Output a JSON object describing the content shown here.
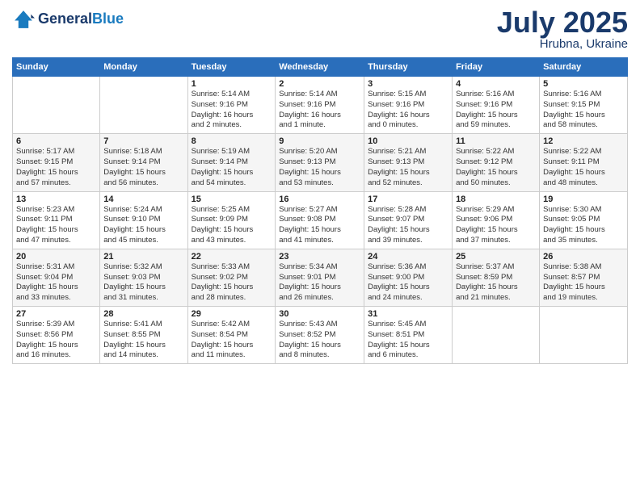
{
  "header": {
    "logo_general": "General",
    "logo_blue": "Blue",
    "month": "July 2025",
    "location": "Hrubna, Ukraine"
  },
  "days_of_week": [
    "Sunday",
    "Monday",
    "Tuesday",
    "Wednesday",
    "Thursday",
    "Friday",
    "Saturday"
  ],
  "weeks": [
    [
      {
        "day": "",
        "detail": ""
      },
      {
        "day": "",
        "detail": ""
      },
      {
        "day": "1",
        "detail": "Sunrise: 5:14 AM\nSunset: 9:16 PM\nDaylight: 16 hours\nand 2 minutes."
      },
      {
        "day": "2",
        "detail": "Sunrise: 5:14 AM\nSunset: 9:16 PM\nDaylight: 16 hours\nand 1 minute."
      },
      {
        "day": "3",
        "detail": "Sunrise: 5:15 AM\nSunset: 9:16 PM\nDaylight: 16 hours\nand 0 minutes."
      },
      {
        "day": "4",
        "detail": "Sunrise: 5:16 AM\nSunset: 9:16 PM\nDaylight: 15 hours\nand 59 minutes."
      },
      {
        "day": "5",
        "detail": "Sunrise: 5:16 AM\nSunset: 9:15 PM\nDaylight: 15 hours\nand 58 minutes."
      }
    ],
    [
      {
        "day": "6",
        "detail": "Sunrise: 5:17 AM\nSunset: 9:15 PM\nDaylight: 15 hours\nand 57 minutes."
      },
      {
        "day": "7",
        "detail": "Sunrise: 5:18 AM\nSunset: 9:14 PM\nDaylight: 15 hours\nand 56 minutes."
      },
      {
        "day": "8",
        "detail": "Sunrise: 5:19 AM\nSunset: 9:14 PM\nDaylight: 15 hours\nand 54 minutes."
      },
      {
        "day": "9",
        "detail": "Sunrise: 5:20 AM\nSunset: 9:13 PM\nDaylight: 15 hours\nand 53 minutes."
      },
      {
        "day": "10",
        "detail": "Sunrise: 5:21 AM\nSunset: 9:13 PM\nDaylight: 15 hours\nand 52 minutes."
      },
      {
        "day": "11",
        "detail": "Sunrise: 5:22 AM\nSunset: 9:12 PM\nDaylight: 15 hours\nand 50 minutes."
      },
      {
        "day": "12",
        "detail": "Sunrise: 5:22 AM\nSunset: 9:11 PM\nDaylight: 15 hours\nand 48 minutes."
      }
    ],
    [
      {
        "day": "13",
        "detail": "Sunrise: 5:23 AM\nSunset: 9:11 PM\nDaylight: 15 hours\nand 47 minutes."
      },
      {
        "day": "14",
        "detail": "Sunrise: 5:24 AM\nSunset: 9:10 PM\nDaylight: 15 hours\nand 45 minutes."
      },
      {
        "day": "15",
        "detail": "Sunrise: 5:25 AM\nSunset: 9:09 PM\nDaylight: 15 hours\nand 43 minutes."
      },
      {
        "day": "16",
        "detail": "Sunrise: 5:27 AM\nSunset: 9:08 PM\nDaylight: 15 hours\nand 41 minutes."
      },
      {
        "day": "17",
        "detail": "Sunrise: 5:28 AM\nSunset: 9:07 PM\nDaylight: 15 hours\nand 39 minutes."
      },
      {
        "day": "18",
        "detail": "Sunrise: 5:29 AM\nSunset: 9:06 PM\nDaylight: 15 hours\nand 37 minutes."
      },
      {
        "day": "19",
        "detail": "Sunrise: 5:30 AM\nSunset: 9:05 PM\nDaylight: 15 hours\nand 35 minutes."
      }
    ],
    [
      {
        "day": "20",
        "detail": "Sunrise: 5:31 AM\nSunset: 9:04 PM\nDaylight: 15 hours\nand 33 minutes."
      },
      {
        "day": "21",
        "detail": "Sunrise: 5:32 AM\nSunset: 9:03 PM\nDaylight: 15 hours\nand 31 minutes."
      },
      {
        "day": "22",
        "detail": "Sunrise: 5:33 AM\nSunset: 9:02 PM\nDaylight: 15 hours\nand 28 minutes."
      },
      {
        "day": "23",
        "detail": "Sunrise: 5:34 AM\nSunset: 9:01 PM\nDaylight: 15 hours\nand 26 minutes."
      },
      {
        "day": "24",
        "detail": "Sunrise: 5:36 AM\nSunset: 9:00 PM\nDaylight: 15 hours\nand 24 minutes."
      },
      {
        "day": "25",
        "detail": "Sunrise: 5:37 AM\nSunset: 8:59 PM\nDaylight: 15 hours\nand 21 minutes."
      },
      {
        "day": "26",
        "detail": "Sunrise: 5:38 AM\nSunset: 8:57 PM\nDaylight: 15 hours\nand 19 minutes."
      }
    ],
    [
      {
        "day": "27",
        "detail": "Sunrise: 5:39 AM\nSunset: 8:56 PM\nDaylight: 15 hours\nand 16 minutes."
      },
      {
        "day": "28",
        "detail": "Sunrise: 5:41 AM\nSunset: 8:55 PM\nDaylight: 15 hours\nand 14 minutes."
      },
      {
        "day": "29",
        "detail": "Sunrise: 5:42 AM\nSunset: 8:54 PM\nDaylight: 15 hours\nand 11 minutes."
      },
      {
        "day": "30",
        "detail": "Sunrise: 5:43 AM\nSunset: 8:52 PM\nDaylight: 15 hours\nand 8 minutes."
      },
      {
        "day": "31",
        "detail": "Sunrise: 5:45 AM\nSunset: 8:51 PM\nDaylight: 15 hours\nand 6 minutes."
      },
      {
        "day": "",
        "detail": ""
      },
      {
        "day": "",
        "detail": ""
      }
    ]
  ]
}
